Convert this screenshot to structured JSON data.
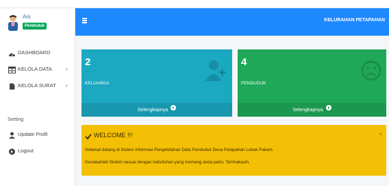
{
  "user": {
    "name": "Ani",
    "role": "Penduduk"
  },
  "sidebar": {
    "items": [
      {
        "label": "DASHBOARD",
        "icon": "dashboard-icon"
      },
      {
        "label": "KELOLA DATA",
        "icon": "table-icon",
        "chevron": "‹"
      },
      {
        "label": "KELOLA SURAT",
        "icon": "file-icon",
        "chevron": "‹"
      }
    ],
    "section_setting": "Setting",
    "setting_items": [
      {
        "label": "Update Profil",
        "icon": "user-icon"
      },
      {
        "label": "Logout",
        "icon": "logout-icon"
      }
    ]
  },
  "header": {
    "title": "KELURAHAN PETAPAHAN",
    "brand_color": "#1e88ff"
  },
  "boxes": [
    {
      "value": "2",
      "label": "KELUARGA",
      "footer": "Selengkapnya",
      "color": "#1ba8c1",
      "icon": "user-plus-icon"
    },
    {
      "value": "4",
      "label": "PENDUDUK",
      "footer": "Selengkapnya",
      "color": "#1fa858",
      "icon": "frown-icon"
    }
  ],
  "alert": {
    "title": "WELCOME !!!",
    "close": "×",
    "line1": "Selamat datang di Sistem Informasi Pengelolahan Data Penduduk Desa Petapahan Lubuk Pakam.",
    "line2": "Gunakanlah Sistem sesuai dengan kebutuhan yang memang anda perlu. Terimakasih.",
    "color": "#f4c005"
  }
}
